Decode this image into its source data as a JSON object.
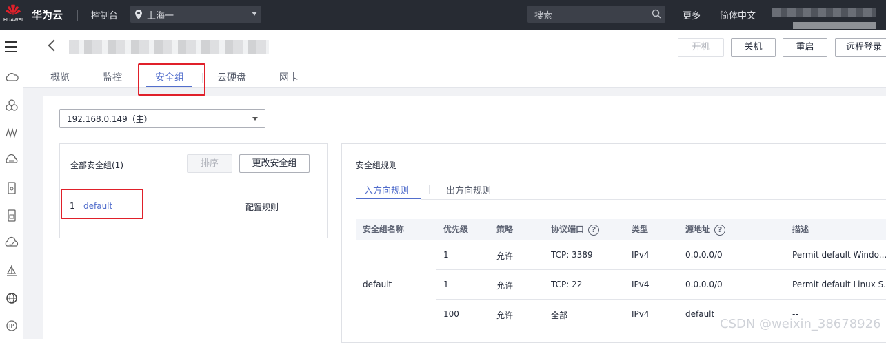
{
  "topbar": {
    "logo_text": "HUAWEI",
    "brand": "华为云",
    "console": "控制台",
    "region": "上海一",
    "search_placeholder": "搜索",
    "more": "更多",
    "language": "简体中文"
  },
  "header": {
    "buttons": {
      "start": "开机",
      "stop": "关机",
      "restart": "重启",
      "remote_login": "远程登录"
    },
    "tabs": [
      "概览",
      "监控",
      "安全组",
      "云硬盘",
      "网卡"
    ],
    "active_tab": "安全组"
  },
  "nic_select": "192.168.0.149（主）",
  "left_panel": {
    "title": "全部安全组(1)",
    "sort_button": "排序",
    "change_button": "更改安全组",
    "row_index": "1",
    "row_name": "default",
    "row_action": "配置规则"
  },
  "right_panel": {
    "title": "安全组规则",
    "tabs": [
      "入方向规则",
      "出方向规则"
    ],
    "active_tab": "入方向规则",
    "columns": [
      "安全组名称",
      "优先级",
      "策略",
      "协议端口",
      "类型",
      "源地址",
      "描述"
    ],
    "group_name": "default",
    "rows": [
      {
        "priority": "1",
        "policy": "允许",
        "port": "TCP: 3389",
        "type": "IPv4",
        "source": "0.0.0.0/0",
        "desc": "Permit default Windo..."
      },
      {
        "priority": "1",
        "policy": "允许",
        "port": "TCP: 22",
        "type": "IPv4",
        "source": "0.0.0.0/0",
        "desc": "Permit default Linux S..."
      },
      {
        "priority": "100",
        "policy": "允许",
        "port": "全部",
        "type": "IPv4",
        "source": "default",
        "desc": "--"
      }
    ]
  },
  "watermark": "CSDN @weixin_38678926",
  "colors": {
    "accent": "#526ecc",
    "highlight": "#e0202a",
    "topbar": "#272b33"
  }
}
